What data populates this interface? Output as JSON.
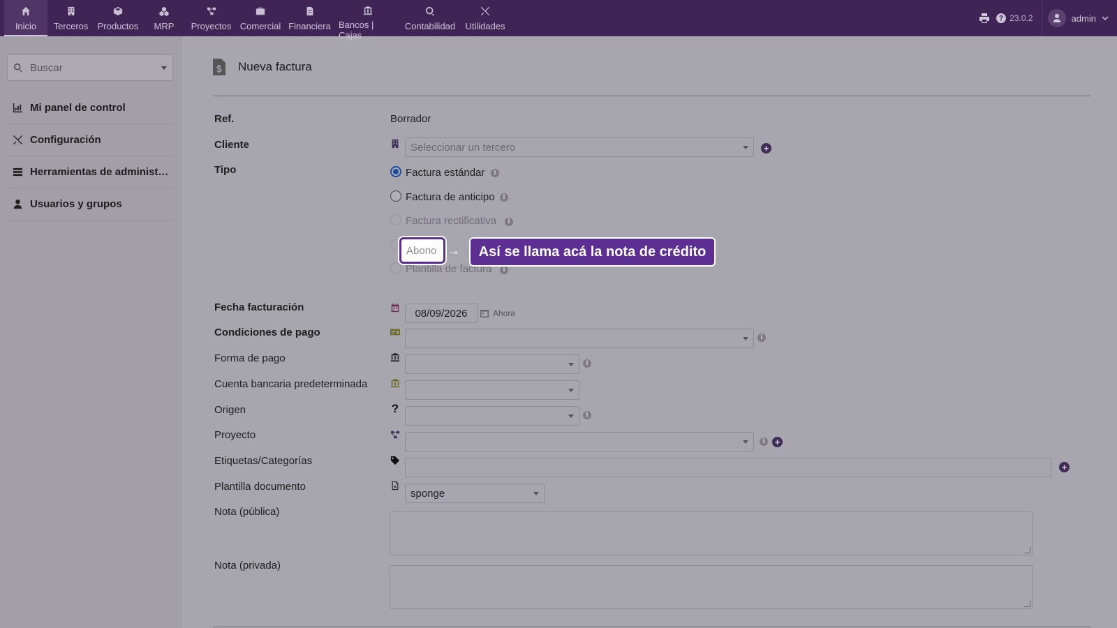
{
  "topmenu": [
    {
      "label": "Inicio",
      "icon": "home-icon",
      "active": true
    },
    {
      "label": "Terceros",
      "icon": "building-icon"
    },
    {
      "label": "Productos",
      "icon": "cube-icon"
    },
    {
      "label": "MRP",
      "icon": "cubes-icon"
    },
    {
      "label": "Proyectos",
      "icon": "project-diagram-icon"
    },
    {
      "label": "Comercial",
      "icon": "suitcase-icon"
    },
    {
      "label": "Financiera",
      "icon": "file-invoice-icon"
    },
    {
      "label": "Bancos | Cajas",
      "icon": "bank-icon"
    },
    {
      "label": "Contabilidad",
      "icon": "search-dollar-icon"
    },
    {
      "label": "Utilidades",
      "icon": "tools-icon"
    }
  ],
  "topright": {
    "version": "23.0.2",
    "username": "admin"
  },
  "sidebar": {
    "search_placeholder": "Buscar",
    "items": [
      {
        "label": "Mi panel de control",
        "icon": "chart-icon"
      },
      {
        "label": "Configuración",
        "icon": "tools-icon"
      },
      {
        "label": "Herramientas de administ…",
        "icon": "server-icon"
      },
      {
        "label": "Usuarios y grupos",
        "icon": "user-icon"
      }
    ]
  },
  "page": {
    "title": "Nueva factura"
  },
  "form": {
    "ref": {
      "label": "Ref.",
      "value": "Borrador"
    },
    "cliente": {
      "label": "Cliente",
      "placeholder": "Seleccionar un tercero"
    },
    "tipo": {
      "label": "Tipo",
      "options": [
        {
          "label": "Factura estándar",
          "checked": true
        },
        {
          "label": "Factura de anticipo"
        },
        {
          "label": "Factura rectificativa",
          "disabled": true
        },
        {
          "label": "Abono",
          "disabled": true
        },
        {
          "label": "Plantilla de factura",
          "disabled": true
        }
      ]
    },
    "fecha": {
      "label": "Fecha facturación",
      "value": "08/09/2026",
      "now_label": "Ahora"
    },
    "condiciones": {
      "label": "Condiciones de pago",
      "value": ""
    },
    "forma_pago": {
      "label": "Forma de pago",
      "value": ""
    },
    "cuenta": {
      "label": "Cuenta bancaria predeterminada",
      "value": ""
    },
    "origen": {
      "label": "Origen",
      "value": ""
    },
    "proyecto": {
      "label": "Proyecto",
      "value": ""
    },
    "etiquetas": {
      "label": "Etiquetas/Categorías",
      "value": ""
    },
    "plantilla": {
      "label": "Plantilla documento",
      "value": "sponge"
    },
    "nota_publica": {
      "label": "Nota (pública)"
    },
    "nota_privada": {
      "label": "Nota (privada)"
    }
  },
  "tour": {
    "highlight_label": "Abono",
    "arrow": "→",
    "tooltip": "Así se llama acá la nota de crédito"
  },
  "colors": {
    "topbar": "#3f2455",
    "accent": "#5e2f92",
    "radio_checked": "#1d4c9a"
  }
}
